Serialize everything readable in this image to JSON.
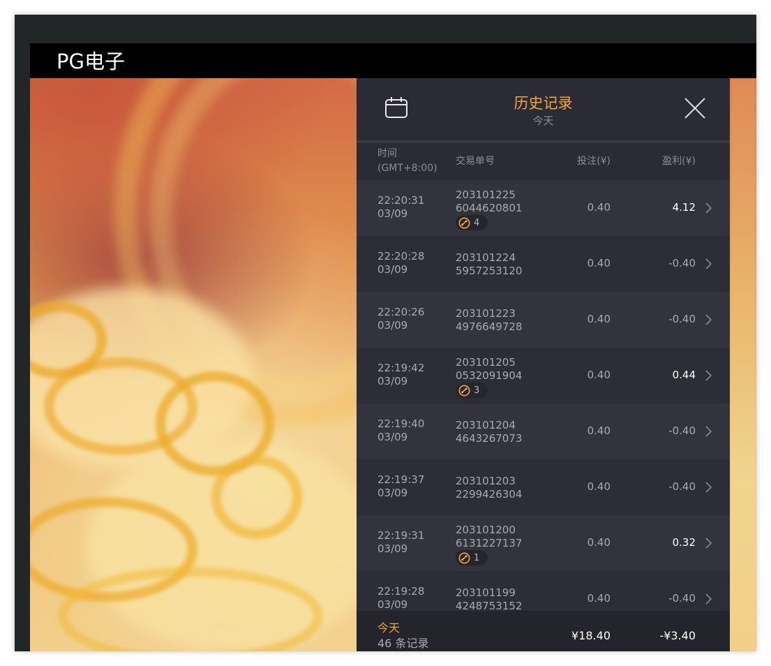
{
  "app": {
    "title": "PG电子"
  },
  "history": {
    "title": "历史记录",
    "subtitle": "今天",
    "calendar_icon": "calendar-icon",
    "close_icon": "close-icon",
    "columns": {
      "time": "时间",
      "timezone": "(GMT+8:00)",
      "order": "交易单号",
      "bet": "投注(¥)",
      "profit": "盈利(¥)"
    },
    "rows": [
      {
        "time": "22:20:31",
        "date": "03/09",
        "order1": "203101225",
        "order2": "6044620801",
        "badge": "4",
        "bet": "0.40",
        "profit": "4.12"
      },
      {
        "time": "22:20:28",
        "date": "03/09",
        "order1": "203101224",
        "order2": "5957253120",
        "badge": null,
        "bet": "0.40",
        "profit": "-0.40"
      },
      {
        "time": "22:20:26",
        "date": "03/09",
        "order1": "203101223",
        "order2": "4976649728",
        "badge": null,
        "bet": "0.40",
        "profit": "-0.40"
      },
      {
        "time": "22:19:42",
        "date": "03/09",
        "order1": "203101205",
        "order2": "0532091904",
        "badge": "3",
        "bet": "0.40",
        "profit": "0.44"
      },
      {
        "time": "22:19:40",
        "date": "03/09",
        "order1": "203101204",
        "order2": "4643267073",
        "badge": null,
        "bet": "0.40",
        "profit": "-0.40"
      },
      {
        "time": "22:19:37",
        "date": "03/09",
        "order1": "203101203",
        "order2": "2299426304",
        "badge": null,
        "bet": "0.40",
        "profit": "-0.40"
      },
      {
        "time": "22:19:31",
        "date": "03/09",
        "order1": "203101200",
        "order2": "6131227137",
        "badge": "1",
        "bet": "0.40",
        "profit": "0.32"
      },
      {
        "time": "22:19:28",
        "date": "03/09",
        "order1": "203101199",
        "order2": "4248753152",
        "badge": null,
        "bet": "0.40",
        "profit": "-0.40"
      }
    ],
    "footer": {
      "label": "今天",
      "count": "46 条记录",
      "bet_total": "¥18.40",
      "profit_total": "-¥3.40"
    }
  },
  "colors": {
    "accent": "#f4a53d",
    "panel_bg": "#2b2b35",
    "positive_text": "#ffffff"
  }
}
